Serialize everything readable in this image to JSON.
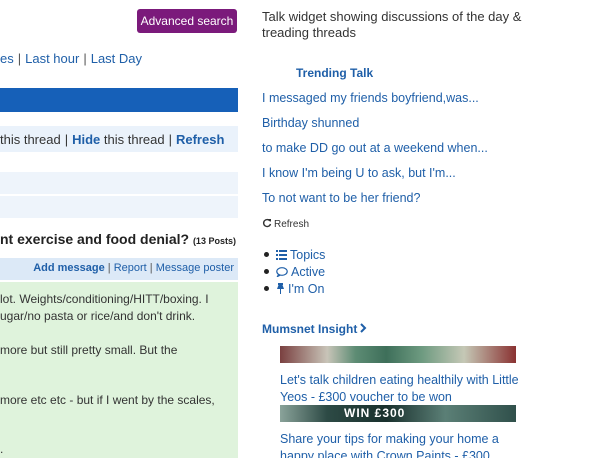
{
  "search": {
    "advanced_label": "Advanced search"
  },
  "time_filters": {
    "items": [
      "es",
      "Last hour",
      "Last Day"
    ]
  },
  "thread_actions": {
    "t1": "this thread",
    "hide": "Hide",
    "t2": "this thread",
    "refresh": "Refresh"
  },
  "thread": {
    "title": "nt exercise and food denial?",
    "post_count": "(13 Posts)"
  },
  "post_actions": {
    "add": "Add message",
    "report": "Report",
    "message": "Message poster"
  },
  "post": {
    "lines": [
      "lot. Weights/conditioning/HITT/boxing. I",
      "ugar/no pasta or rice/and don't drink.",
      "more but still pretty small. But the",
      "more etc etc - but if I went by the scales,",
      "."
    ]
  },
  "sidebar": {
    "description": "Talk widget showing discussions of the day & treading threads",
    "trending_heading": "Trending Talk",
    "trending": [
      "I messaged my friends boyfriend,was...",
      "Birthday shunned",
      "to make DD go out at a weekend when...",
      "I know I'm being U to ask, but I'm...",
      "To not want to be her friend?"
    ],
    "refresh_label": "Refresh",
    "nav": [
      {
        "label": "Topics",
        "icon": "list-icon"
      },
      {
        "label": "Active",
        "icon": "speech-bubble-icon"
      },
      {
        "label": "I'm On",
        "icon": "pin-icon"
      }
    ],
    "insight_heading": "Mumsnet Insight",
    "insight_links": [
      "Let's talk children eating healthily with Little Yeos - £300 voucher to be won",
      "Share your tips for making your home a happy place with Crown Paints - £300"
    ],
    "image_text": "WIN £300"
  },
  "colors": {
    "brand_purple": "#7b1a7b",
    "link_blue": "#1f5fa8",
    "header_blue": "#1660b8",
    "post_green": "#dff3dc"
  }
}
